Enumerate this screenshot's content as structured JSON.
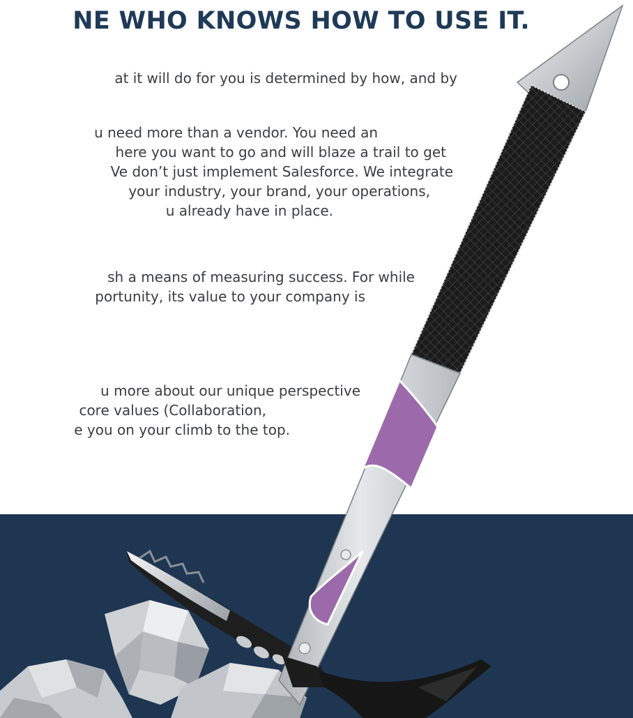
{
  "headline": "NE WHO KNOWS HOW TO USE IT.",
  "paragraphs": [
    {
      "lines": [
        "at it will do for you is determined by how, and by"
      ]
    },
    {
      "lines": [
        "u need more than a vendor. You need an",
        "here you want to go and will blaze a trail to get",
        "Ve don’t just implement Salesforce. We integrate",
        "your industry, your brand, your operations,",
        "u already have in place."
      ]
    },
    {
      "lines": [
        "sh a means of measuring success. For while",
        "portunity, its value to your company is"
      ]
    },
    {
      "lines": [
        "u more about our unique perspective",
        "core values (Collaboration,",
        "e you on your climb to the top."
      ]
    }
  ],
  "colors": {
    "headline": "#1f3a57",
    "body_text": "#3b3d40",
    "dark_band": "#1e3652",
    "grip": "#1a1a1a",
    "accent_purple": "#9c6aab",
    "metal": "#c9ccd0",
    "rock": "#bfc2c6"
  },
  "illustration": {
    "subject": "ice-axe-icon",
    "rock": "rock-icon"
  }
}
